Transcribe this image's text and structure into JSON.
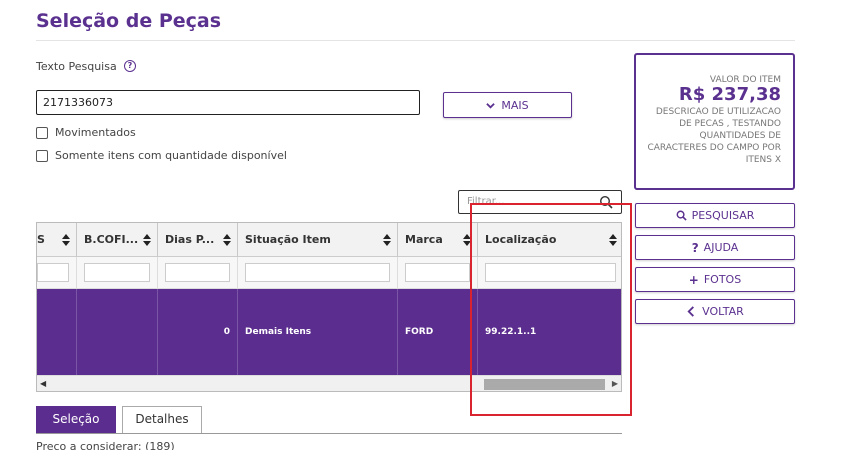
{
  "page": {
    "title": "Seleção de Peças"
  },
  "search": {
    "label": "Texto Pesquisa",
    "help_glyph": "?",
    "value": "2171336073",
    "more_label": "MAIS"
  },
  "options": {
    "movimentados": "Movimentados",
    "somente_disponivel": "Somente itens com quantidade disponível"
  },
  "filter": {
    "placeholder": "Filtrar..."
  },
  "grid": {
    "columns": [
      "S",
      "B.COFI...",
      "Dias P...",
      "Situação Item",
      "Marca",
      "Localização"
    ],
    "row": [
      "",
      "",
      "0",
      "Demais Itens",
      "FORD",
      "99.22.1..1"
    ]
  },
  "tabs": {
    "selecao": "Seleção",
    "detalhes": "Detalhes"
  },
  "footer": {
    "preco_text": "Preço a considerar: (189)"
  },
  "value_card": {
    "label": "VALOR DO ITEM",
    "amount": "R$  237,38",
    "description": "DESCRICAO DE UTILIZACAO DE PECAS , TESTANDO QUANTIDADES DE CARACTERES DO CAMPO POR ITENS X"
  },
  "actions": {
    "pesquisar": "PESQUISAR",
    "ajuda": "AJUDA",
    "fotos": "FOTOS",
    "voltar": "VOLTAR"
  },
  "colors": {
    "brand_purple": "#5b2d8e",
    "highlight_red": "#d9232e"
  },
  "icons": [
    "chevron-down-icon",
    "search-icon",
    "sort-icon",
    "question-icon",
    "plus-icon",
    "chevron-left-icon"
  ]
}
